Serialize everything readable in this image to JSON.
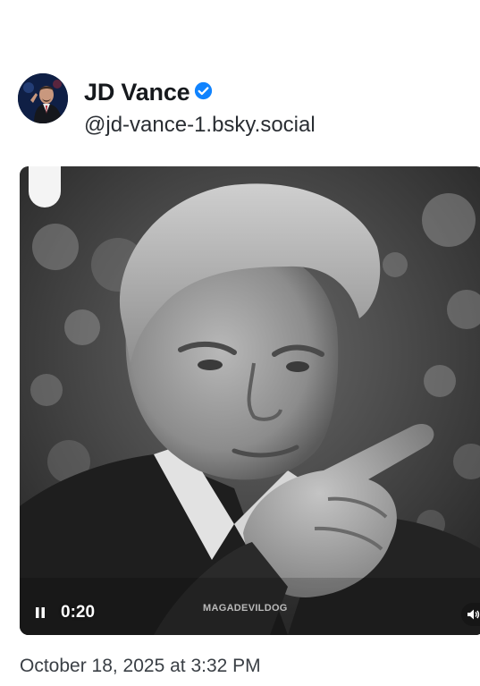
{
  "post": {
    "author": {
      "display_name": "JD Vance",
      "handle": "@jd-vance-1.bsky.social",
      "verified": true
    },
    "video": {
      "elapsed_time": "0:20",
      "watermark": "MAGADEVILDOG",
      "state": "playing"
    },
    "timestamp": "October 18, 2025 at 3:32 PM"
  },
  "colors": {
    "verified_badge": "#1083fe",
    "text_primary": "#16191d",
    "text_secondary": "#3a3f45"
  },
  "icons": {
    "verified": "verified-check-icon",
    "pause": "pause-icon",
    "volume": "volume-icon"
  }
}
